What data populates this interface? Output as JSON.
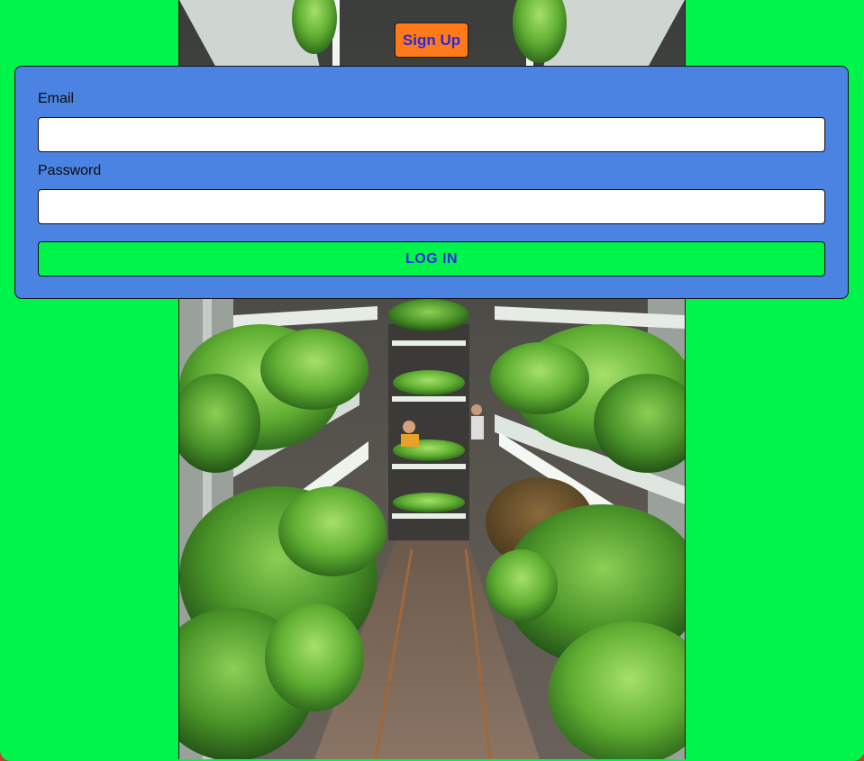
{
  "header": {
    "signup_label": "Sign Up"
  },
  "login_form": {
    "email_label": "Email",
    "email_value": "",
    "password_label": "Password",
    "password_value": "",
    "submit_label": "LOG IN"
  },
  "colors": {
    "page_background": "#00f54a",
    "card_background": "#4a83e2",
    "signup_button": "#ff7a1a",
    "login_button": "#00f54a",
    "button_text": "#2a2ad8"
  },
  "hero_image": {
    "icon": "vertical-farm-photo"
  }
}
